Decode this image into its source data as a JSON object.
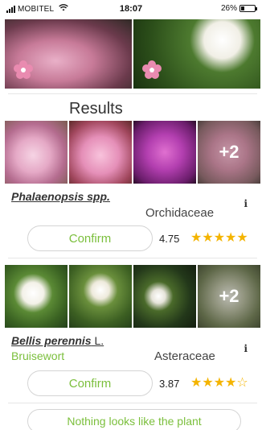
{
  "status_bar": {
    "carrier": "MOBITEL",
    "time": "18:07",
    "battery_text": "26%",
    "battery_level": 0.26
  },
  "results_title": "Results",
  "results": [
    {
      "scientific_name": "Phalaenopsis spp.",
      "author": "",
      "common_name": "",
      "family": "Orchidaceae",
      "more_images": "+2",
      "confirm_label": "Confirm",
      "score": "4.75",
      "stars": "★★★★★"
    },
    {
      "scientific_name": "Bellis perennis",
      "author": "L.",
      "common_name": "Bruisewort",
      "family": "Asteraceae",
      "more_images": "+2",
      "confirm_label": "Confirm",
      "score": "3.87",
      "stars": "★★★★☆"
    }
  ],
  "info_icon": "i",
  "nothing_button": "Nothing looks like the plant",
  "icons": {
    "signal": "signal-icon",
    "wifi": "wifi-icon",
    "battery": "battery-icon",
    "flower": "flower-icon",
    "info": "info-icon"
  },
  "colors": {
    "accent_green": "#7bbf3c",
    "star_gold": "#f4b400"
  }
}
